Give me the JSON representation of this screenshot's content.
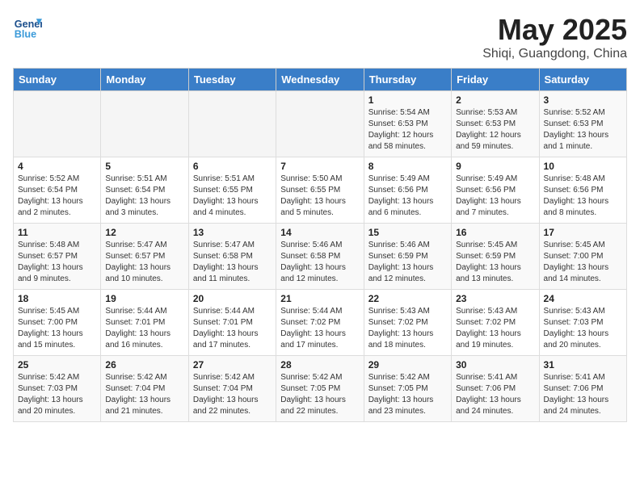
{
  "header": {
    "logo_line1": "General",
    "logo_line2": "Blue",
    "month_title": "May 2025",
    "location": "Shiqi, Guangdong, China"
  },
  "weekdays": [
    "Sunday",
    "Monday",
    "Tuesday",
    "Wednesday",
    "Thursday",
    "Friday",
    "Saturday"
  ],
  "weeks": [
    [
      {
        "day": "",
        "info": ""
      },
      {
        "day": "",
        "info": ""
      },
      {
        "day": "",
        "info": ""
      },
      {
        "day": "",
        "info": ""
      },
      {
        "day": "1",
        "info": "Sunrise: 5:54 AM\nSunset: 6:53 PM\nDaylight: 12 hours\nand 58 minutes."
      },
      {
        "day": "2",
        "info": "Sunrise: 5:53 AM\nSunset: 6:53 PM\nDaylight: 12 hours\nand 59 minutes."
      },
      {
        "day": "3",
        "info": "Sunrise: 5:52 AM\nSunset: 6:53 PM\nDaylight: 13 hours\nand 1 minute."
      }
    ],
    [
      {
        "day": "4",
        "info": "Sunrise: 5:52 AM\nSunset: 6:54 PM\nDaylight: 13 hours\nand 2 minutes."
      },
      {
        "day": "5",
        "info": "Sunrise: 5:51 AM\nSunset: 6:54 PM\nDaylight: 13 hours\nand 3 minutes."
      },
      {
        "day": "6",
        "info": "Sunrise: 5:51 AM\nSunset: 6:55 PM\nDaylight: 13 hours\nand 4 minutes."
      },
      {
        "day": "7",
        "info": "Sunrise: 5:50 AM\nSunset: 6:55 PM\nDaylight: 13 hours\nand 5 minutes."
      },
      {
        "day": "8",
        "info": "Sunrise: 5:49 AM\nSunset: 6:56 PM\nDaylight: 13 hours\nand 6 minutes."
      },
      {
        "day": "9",
        "info": "Sunrise: 5:49 AM\nSunset: 6:56 PM\nDaylight: 13 hours\nand 7 minutes."
      },
      {
        "day": "10",
        "info": "Sunrise: 5:48 AM\nSunset: 6:56 PM\nDaylight: 13 hours\nand 8 minutes."
      }
    ],
    [
      {
        "day": "11",
        "info": "Sunrise: 5:48 AM\nSunset: 6:57 PM\nDaylight: 13 hours\nand 9 minutes."
      },
      {
        "day": "12",
        "info": "Sunrise: 5:47 AM\nSunset: 6:57 PM\nDaylight: 13 hours\nand 10 minutes."
      },
      {
        "day": "13",
        "info": "Sunrise: 5:47 AM\nSunset: 6:58 PM\nDaylight: 13 hours\nand 11 minutes."
      },
      {
        "day": "14",
        "info": "Sunrise: 5:46 AM\nSunset: 6:58 PM\nDaylight: 13 hours\nand 12 minutes."
      },
      {
        "day": "15",
        "info": "Sunrise: 5:46 AM\nSunset: 6:59 PM\nDaylight: 13 hours\nand 12 minutes."
      },
      {
        "day": "16",
        "info": "Sunrise: 5:45 AM\nSunset: 6:59 PM\nDaylight: 13 hours\nand 13 minutes."
      },
      {
        "day": "17",
        "info": "Sunrise: 5:45 AM\nSunset: 7:00 PM\nDaylight: 13 hours\nand 14 minutes."
      }
    ],
    [
      {
        "day": "18",
        "info": "Sunrise: 5:45 AM\nSunset: 7:00 PM\nDaylight: 13 hours\nand 15 minutes."
      },
      {
        "day": "19",
        "info": "Sunrise: 5:44 AM\nSunset: 7:01 PM\nDaylight: 13 hours\nand 16 minutes."
      },
      {
        "day": "20",
        "info": "Sunrise: 5:44 AM\nSunset: 7:01 PM\nDaylight: 13 hours\nand 17 minutes."
      },
      {
        "day": "21",
        "info": "Sunrise: 5:44 AM\nSunset: 7:02 PM\nDaylight: 13 hours\nand 17 minutes."
      },
      {
        "day": "22",
        "info": "Sunrise: 5:43 AM\nSunset: 7:02 PM\nDaylight: 13 hours\nand 18 minutes."
      },
      {
        "day": "23",
        "info": "Sunrise: 5:43 AM\nSunset: 7:02 PM\nDaylight: 13 hours\nand 19 minutes."
      },
      {
        "day": "24",
        "info": "Sunrise: 5:43 AM\nSunset: 7:03 PM\nDaylight: 13 hours\nand 20 minutes."
      }
    ],
    [
      {
        "day": "25",
        "info": "Sunrise: 5:42 AM\nSunset: 7:03 PM\nDaylight: 13 hours\nand 20 minutes."
      },
      {
        "day": "26",
        "info": "Sunrise: 5:42 AM\nSunset: 7:04 PM\nDaylight: 13 hours\nand 21 minutes."
      },
      {
        "day": "27",
        "info": "Sunrise: 5:42 AM\nSunset: 7:04 PM\nDaylight: 13 hours\nand 22 minutes."
      },
      {
        "day": "28",
        "info": "Sunrise: 5:42 AM\nSunset: 7:05 PM\nDaylight: 13 hours\nand 22 minutes."
      },
      {
        "day": "29",
        "info": "Sunrise: 5:42 AM\nSunset: 7:05 PM\nDaylight: 13 hours\nand 23 minutes."
      },
      {
        "day": "30",
        "info": "Sunrise: 5:41 AM\nSunset: 7:06 PM\nDaylight: 13 hours\nand 24 minutes."
      },
      {
        "day": "31",
        "info": "Sunrise: 5:41 AM\nSunset: 7:06 PM\nDaylight: 13 hours\nand 24 minutes."
      }
    ]
  ]
}
